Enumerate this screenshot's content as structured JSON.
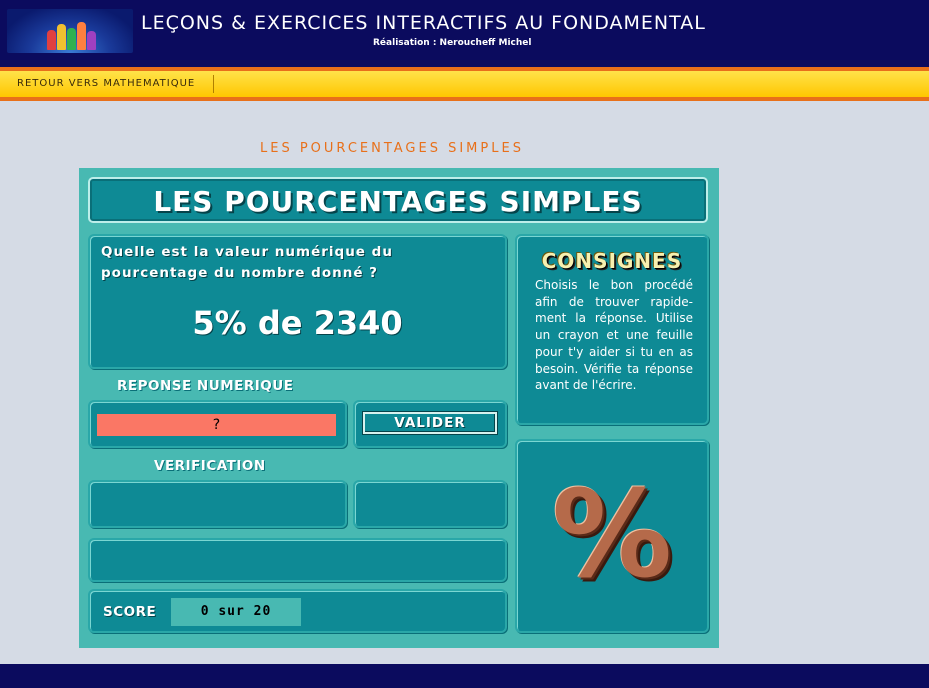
{
  "site": {
    "title": "LEÇONS & EXERCICES INTERACTIFS AU FONDAMENTAL",
    "subtitle": "Réalisation : Neroucheff Michel"
  },
  "nav": {
    "back_link": "RETOUR VERS MATHEMATIQUE"
  },
  "page": {
    "heading": "LES POURCENTAGES SIMPLES"
  },
  "exercise": {
    "title": "LES POURCENTAGES SIMPLES",
    "question": "Quelle est la valeur numérique du pourcentage du nombre donné ?",
    "question_value": "5% de 2340",
    "answer_label": "REPONSE NUMERIQUE",
    "answer_value": "?",
    "validate_label": "VALIDER",
    "verification_label": "VERIFICATION",
    "score_label": "SCORE",
    "score_value": "0 sur 20",
    "consignes_title": "CONSIGNES",
    "consignes_text": "Choisis le bon procédé afin de trouver rapide-ment la réponse. Utilise un crayon et une feuille pour t'y aider si tu en as besoin. Vérifie ta réponse avant de l'écrire.",
    "percent_symbol": "%"
  },
  "colors": {
    "header_bg": "#0b0b5e",
    "nav_bg": "#ffd41a",
    "nav_border": "#e8701a",
    "page_bg": "#d5dbe5",
    "panel_bg": "#48b9b2",
    "box_bg": "#0e8a95",
    "answer_bg": "#fa7765",
    "heading_color": "#e8701a"
  },
  "icons": {
    "logo": "cartoon-children-logo",
    "percent": "percent-sign-icon"
  }
}
